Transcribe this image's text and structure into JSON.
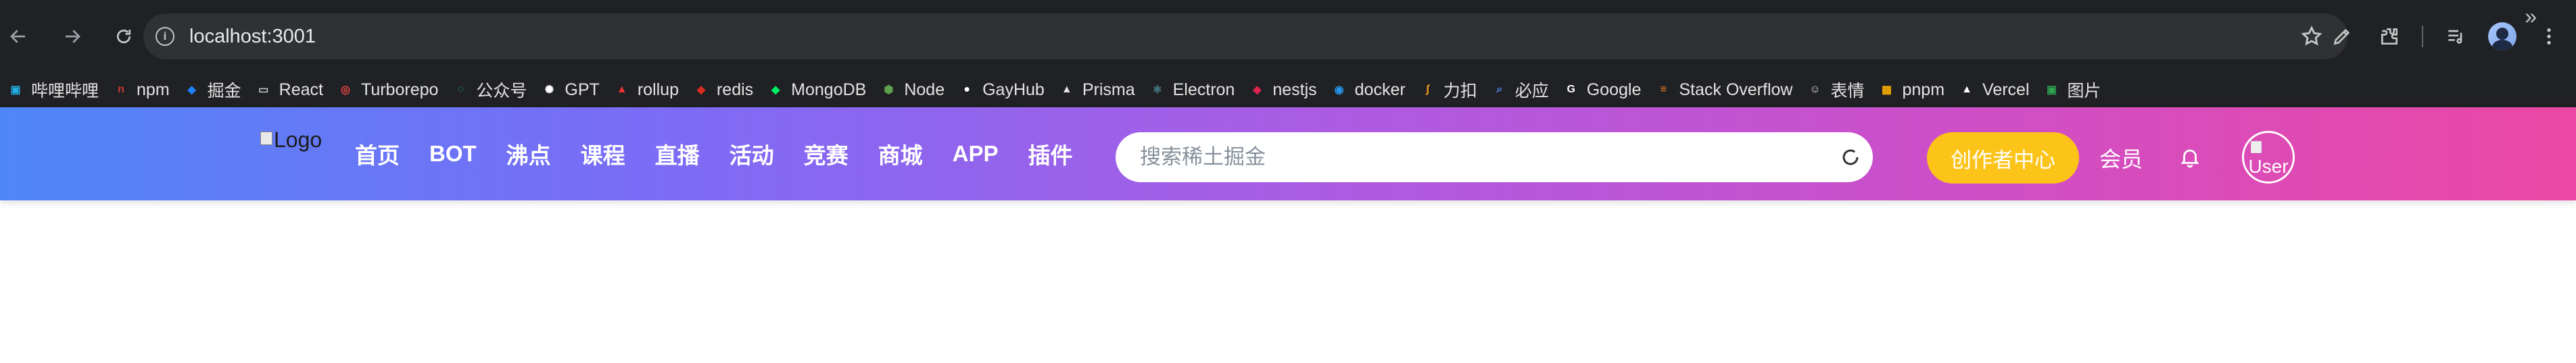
{
  "browser": {
    "url": "localhost:3001",
    "icons": [
      "back-arrow-icon",
      "forward-arrow-icon",
      "reload-icon",
      "site-info-icon",
      "star-icon",
      "pen-icon",
      "extensions-icon",
      "media-queue-icon",
      "profile-avatar",
      "kebab-menu-icon"
    ]
  },
  "bookmarks": [
    {
      "label": "哔哩哔哩",
      "icon": "bilibili-icon",
      "color": "#23ade5"
    },
    {
      "label": "npm",
      "icon": "npm-icon",
      "color": "#cb3837"
    },
    {
      "label": "掘金",
      "icon": "juejin-icon",
      "color": "#1e80ff"
    },
    {
      "label": "React",
      "icon": "folder-icon",
      "color": "#c4c7c5"
    },
    {
      "label": "Turborepo",
      "icon": "turborepo-icon",
      "color": "#ef4444"
    },
    {
      "label": "公众号",
      "icon": "wechat-icon",
      "color": "#07c160"
    },
    {
      "label": "GPT",
      "icon": "openai-icon",
      "color": "#ffffff"
    },
    {
      "label": "rollup",
      "icon": "rollup-icon",
      "color": "#ef3335"
    },
    {
      "label": "redis",
      "icon": "redis-icon",
      "color": "#d82c20"
    },
    {
      "label": "MongoDB",
      "icon": "mongodb-icon",
      "color": "#00ed64"
    },
    {
      "label": "Node",
      "icon": "nodejs-icon",
      "color": "#5fa04e"
    },
    {
      "label": "GayHub",
      "icon": "github-icon",
      "color": "#ffffff"
    },
    {
      "label": "Prisma",
      "icon": "prisma-icon",
      "color": "#e3e3e3"
    },
    {
      "label": "Electron",
      "icon": "electron-icon",
      "color": "#47848f"
    },
    {
      "label": "nestjs",
      "icon": "nestjs-icon",
      "color": "#e0234e"
    },
    {
      "label": "docker",
      "icon": "docker-icon",
      "color": "#2496ed"
    },
    {
      "label": "力扣",
      "icon": "leetcode-icon",
      "color": "#ffa116"
    },
    {
      "label": "必应",
      "icon": "bing-search-icon",
      "color": "#4f8ff7"
    },
    {
      "label": "Google",
      "icon": "google-icon",
      "color": "#ffffff"
    },
    {
      "label": "Stack Overflow",
      "icon": "stackoverflow-icon",
      "color": "#f48024"
    },
    {
      "label": "表情",
      "icon": "emoji-icon",
      "color": "#e3e3e3"
    },
    {
      "label": "pnpm",
      "icon": "pnpm-icon",
      "color": "#f9ad00"
    },
    {
      "label": "Vercel",
      "icon": "vercel-icon",
      "color": "#ffffff"
    },
    {
      "label": "图片",
      "icon": "image-tool-icon",
      "color": "#2ea44f"
    }
  ],
  "header": {
    "logo_alt": "Logo",
    "nav": [
      "首页",
      "BOT",
      "沸点",
      "课程",
      "直播",
      "活动",
      "竞赛",
      "商城",
      "APP",
      "插件"
    ],
    "search_placeholder": "搜索稀土掘金",
    "creator_label": "创作者中心",
    "member_label": "会员",
    "avatar_alt": "User",
    "gradient": [
      "#4f86f7",
      "#7b6cf6",
      "#a95ce4",
      "#cc4fc9",
      "#ec47a3"
    ],
    "creator_color": "#fcc419"
  }
}
